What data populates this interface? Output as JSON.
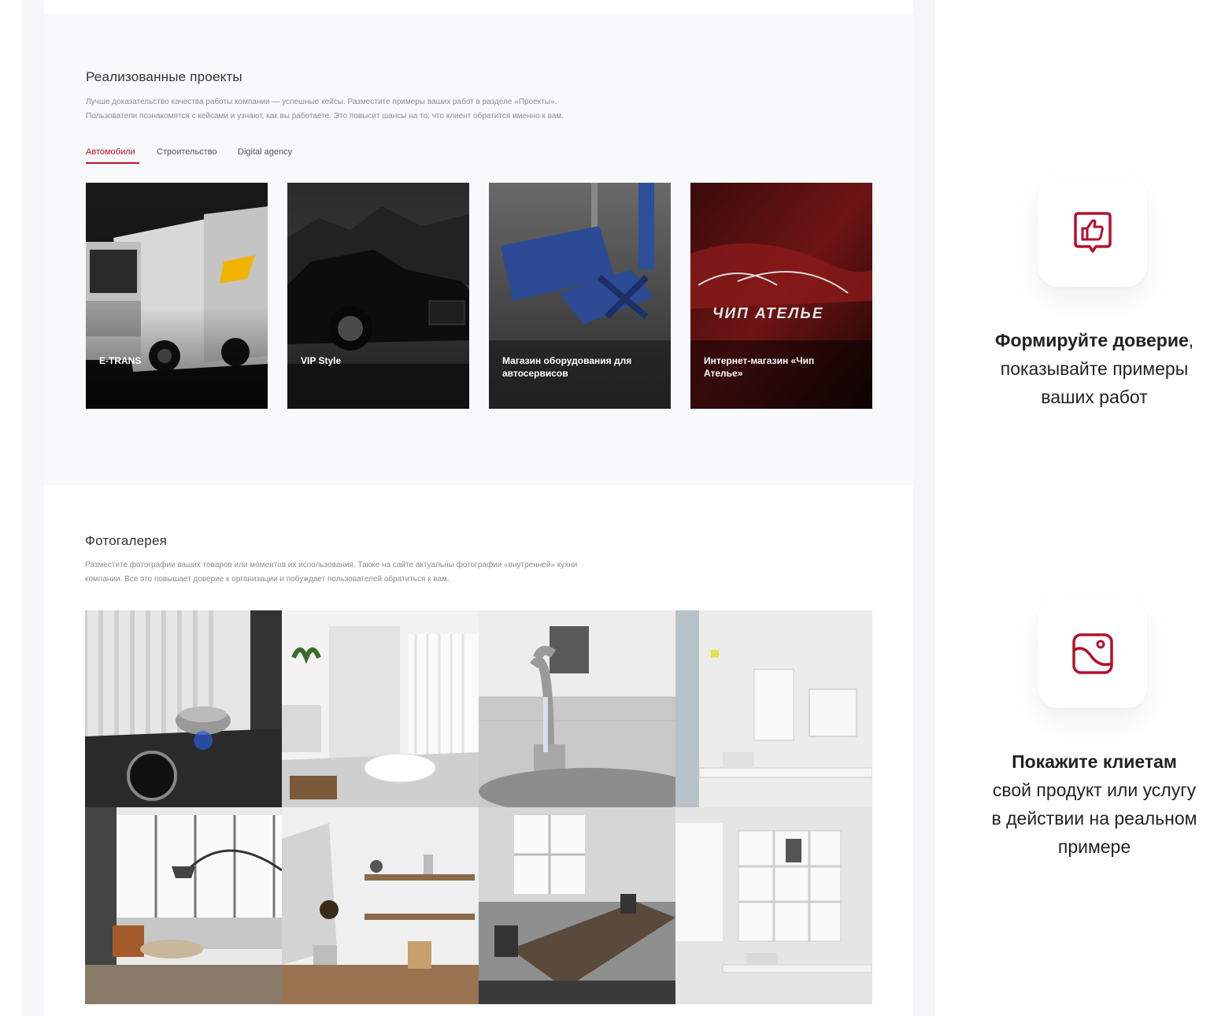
{
  "projects": {
    "title": "Реализованные проекты",
    "desc_line1": "Лучше доказательство качества работы компании — успешные кейсы. Разместите примеры ваших работ в разделе «Проекты».",
    "desc_line2": "Пользователи познакомятся с кейсами и узнают, как вы работаете. Это повысит шансы на то, что клиент обратится именно к вам.",
    "tabs": [
      {
        "label": "Автомобили",
        "active": true
      },
      {
        "label": "Строительство",
        "active": false
      },
      {
        "label": "Digital agency",
        "active": false
      }
    ],
    "cards": [
      {
        "label": "E-TRANS",
        "icon": "truck-photo"
      },
      {
        "label": "VIP Style",
        "icon": "car-photo"
      },
      {
        "label": "Магазин оборудования для автосервисов",
        "icon": "lift-photo"
      },
      {
        "label": "Интернет-магазин «Чип Ателье»",
        "icon": "red-car-photo",
        "overlay_text": "ЧИП АТЕЛЬЕ"
      }
    ]
  },
  "gallery": {
    "title": "Фотогалерея",
    "desc_line1": "Разместите фотографии ваших товаров или моментов их использования. Также на сайте актуальны фотографии «внутренней» кухни",
    "desc_line2": "компании. Все это повышает доверие к организации и побуждает пользователей обратиться к вам.",
    "photos": [
      "stove-photo",
      "bathroom-photo",
      "faucet-photo",
      "office-desk-photo",
      "living-room-photo",
      "kitchen-shelves-photo",
      "meeting-room-photo",
      "office-shelves-photo"
    ]
  },
  "features": [
    {
      "icon": "thumbs-up-icon",
      "bold": "Формируйте доверие",
      "after_bold": ",",
      "line2": "показывайте примеры",
      "line3": "ваших работ"
    },
    {
      "icon": "image-icon",
      "bold": "Покажите клиетам",
      "line2": "свой продукт или услугу",
      "line3": "в действии на реальном",
      "line4": "примере"
    }
  ],
  "colors": {
    "accent": "#c0102a",
    "text": "#222222",
    "muted": "#8c8c8c"
  }
}
